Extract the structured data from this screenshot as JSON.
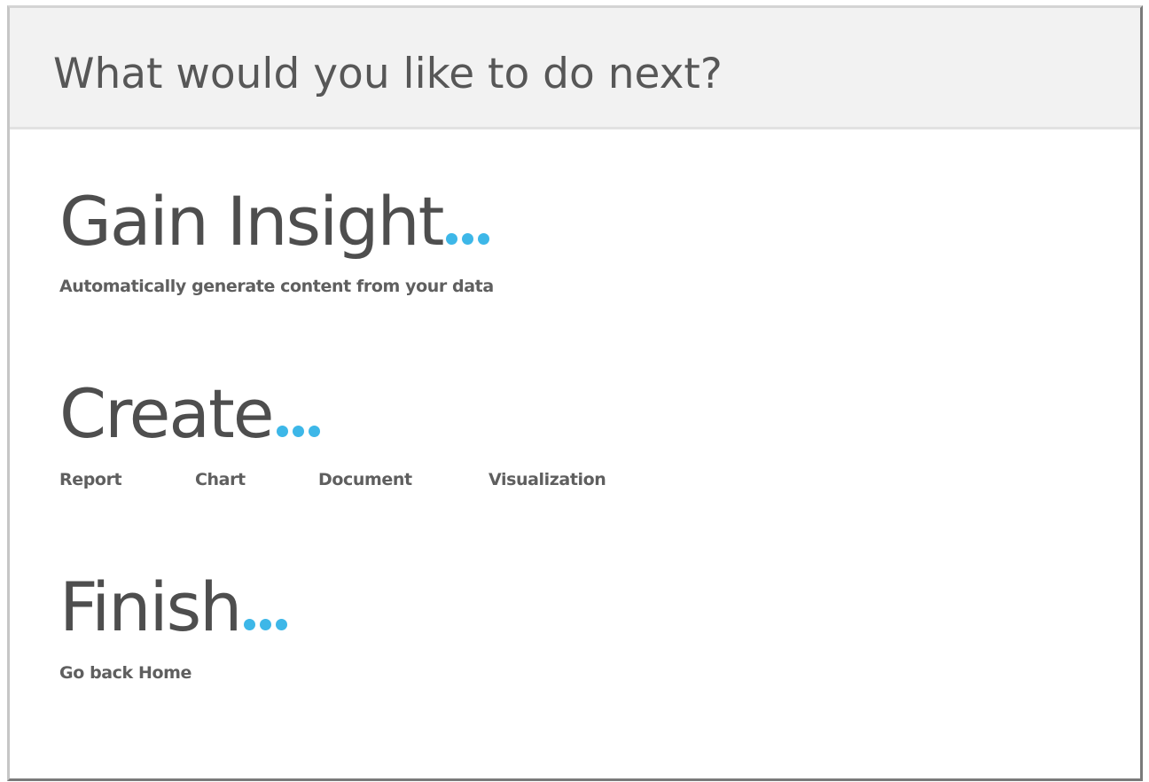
{
  "dialog": {
    "title": "What would you like to do next?"
  },
  "sections": {
    "insight": {
      "heading": "Gain Insight",
      "subtitle": "Automatically generate content from your data"
    },
    "create": {
      "heading": "Create",
      "links": [
        "Report",
        "Chart",
        "Document",
        "Visualization"
      ]
    },
    "finish": {
      "heading": "Finish",
      "link": "Go back Home"
    }
  },
  "colors": {
    "accent": "#3db7e8",
    "heading_text": "#4e4e4e",
    "header_background": "#f2f2f2"
  },
  "icons": {
    "ellipsis": "ellipsis-dots-icon"
  }
}
